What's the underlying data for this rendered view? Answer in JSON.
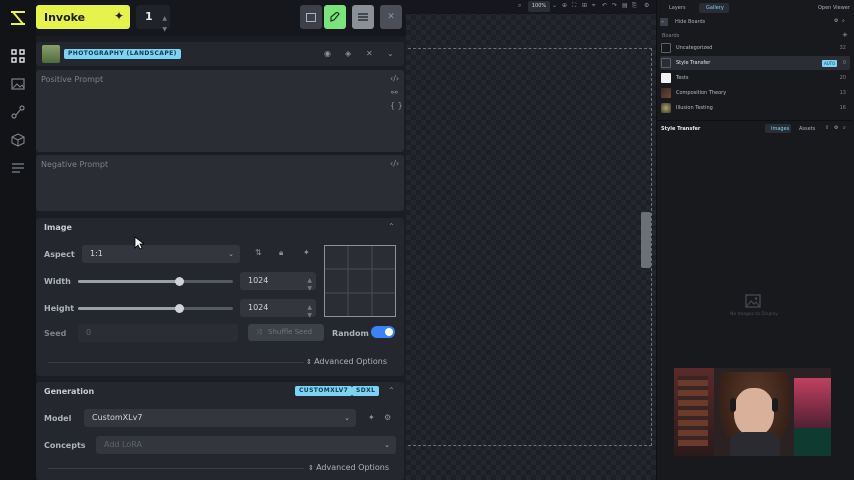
{
  "toolbar": {
    "invoke_label": "Invoke",
    "quantity": "1"
  },
  "style_preset": {
    "tag": "PHOTOGRAPHY (LANDSCAPE)"
  },
  "prompts": {
    "positive_placeholder": "Positive Prompt",
    "negative_placeholder": "Negative Prompt"
  },
  "image": {
    "title": "Image",
    "aspect_label": "Aspect",
    "aspect_value": "1:1",
    "width_label": "Width",
    "width_value": "1024",
    "height_label": "Height",
    "height_value": "1024",
    "seed_label": "Seed",
    "seed_value": "0",
    "shuffle_label": "Shuffle Seed",
    "random_label": "Random",
    "advanced_label": "Advanced Options"
  },
  "generation": {
    "title": "Generation",
    "tag_model": "CUSTOMXLV7",
    "tag_base": "SDXL",
    "model_label": "Model",
    "model_value": "CustomXLv7",
    "concepts_label": "Concepts",
    "concepts_placeholder": "Add LoRA",
    "advanced_label": "Advanced Options"
  },
  "canvas": {
    "zoom": "100%"
  },
  "right_panel": {
    "tab_layers": "Layers",
    "tab_gallery": "Gallery",
    "open_viewer": "Open Viewer",
    "hide_boards": "Hide Boards",
    "boards_heading": "Boards",
    "boards": [
      {
        "name": "Uncategorized",
        "count": "32"
      },
      {
        "name": "Style Transfer",
        "count": "0",
        "badge": "AUTO"
      },
      {
        "name": "Tests",
        "count": "20"
      },
      {
        "name": "Composition Theory",
        "count": "13"
      },
      {
        "name": "Illusion Testing",
        "count": "16"
      }
    ],
    "selected_board": "Style Transfer",
    "tab_images": "Images",
    "tab_assets": "Assets",
    "empty_text": "No Images to Display"
  },
  "colors": {
    "invoke": "#e5f34a",
    "accent": "#7dd3f3",
    "toggle": "#3b82f6",
    "active_tool": "#7be37b"
  }
}
